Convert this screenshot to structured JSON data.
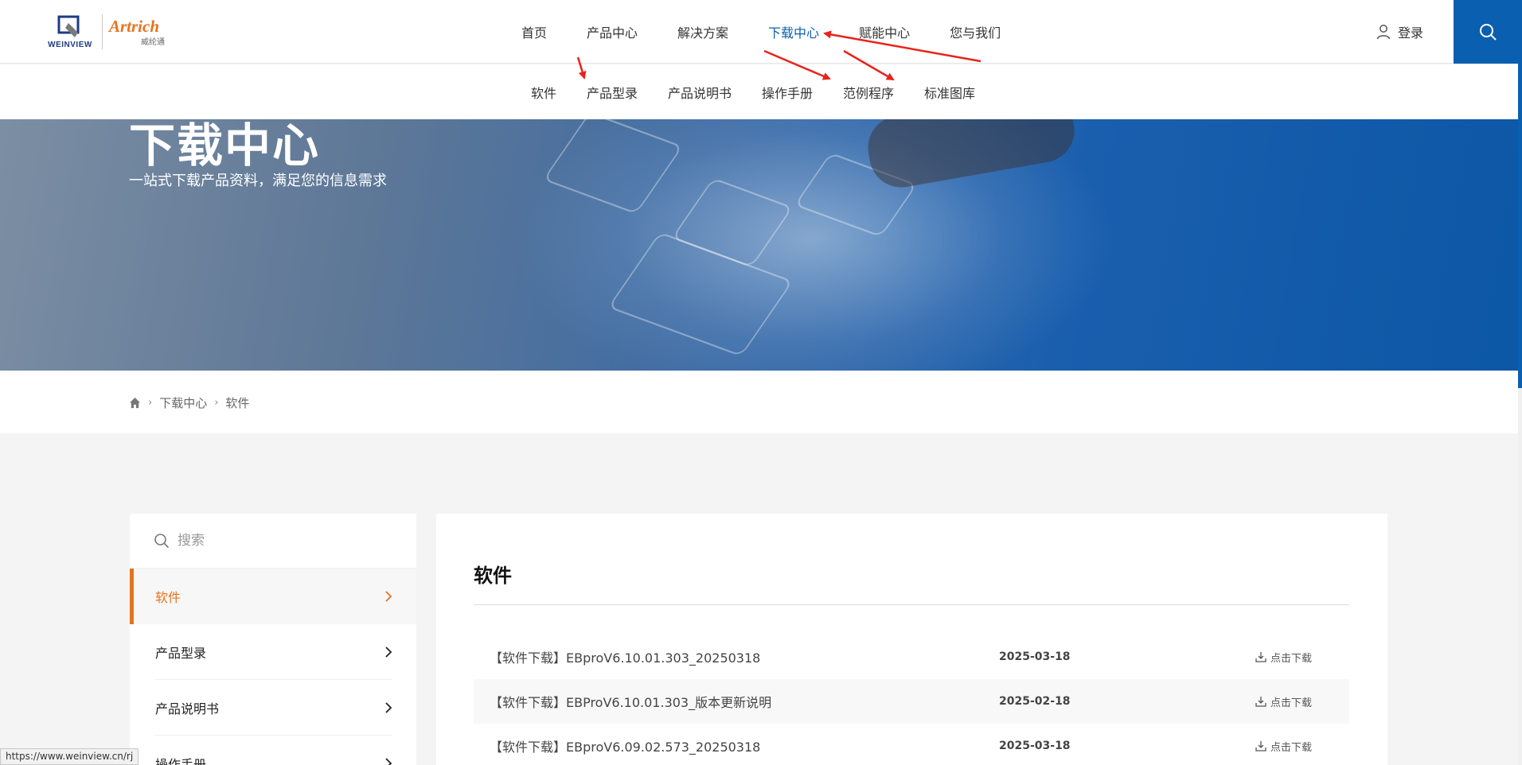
{
  "header": {
    "logo_weinview": "WEINVIEW",
    "logo_artrich": "Artrich",
    "logo_artrich_cn": "威纶通",
    "nav": [
      {
        "label": "首页",
        "active": false
      },
      {
        "label": "产品中心",
        "active": false
      },
      {
        "label": "解决方案",
        "active": false
      },
      {
        "label": "下载中心",
        "active": true
      },
      {
        "label": "赋能中心",
        "active": false
      },
      {
        "label": "您与我们",
        "active": false
      }
    ],
    "login_label": "登录",
    "accent_color": "#0b5fb0"
  },
  "subnav": {
    "items": [
      "软件",
      "产品型录",
      "产品说明书",
      "操作手册",
      "范例程序",
      "标准图库"
    ]
  },
  "banner": {
    "title": "下载中心",
    "subtitle": "一站式下载产品资料，满足您的信息需求"
  },
  "breadcrumb": {
    "home_icon": "home-icon",
    "items": [
      "下载中心",
      "软件"
    ]
  },
  "sidebar": {
    "search_placeholder": "搜索",
    "items": [
      {
        "label": "软件",
        "active": true
      },
      {
        "label": "产品型录",
        "active": false
      },
      {
        "label": "产品说明书",
        "active": false
      },
      {
        "label": "操作手册",
        "active": false
      }
    ],
    "active_color": "#e6731f"
  },
  "main": {
    "title": "软件",
    "download_label": "点击下载",
    "rows": [
      {
        "name": "【软件下载】EBproV6.10.01.303_20250318",
        "date": "2025-03-18"
      },
      {
        "name": "【软件下载】EBProV6.10.01.303_版本更新说明",
        "date": "2025-02-18"
      },
      {
        "name": "【软件下载】EBproV6.09.02.573_20250318",
        "date": "2025-03-18"
      }
    ]
  },
  "statusbar": {
    "url": "https://www.weinview.cn/rj"
  },
  "annotations": {
    "arrow_color": "#e8231c"
  }
}
